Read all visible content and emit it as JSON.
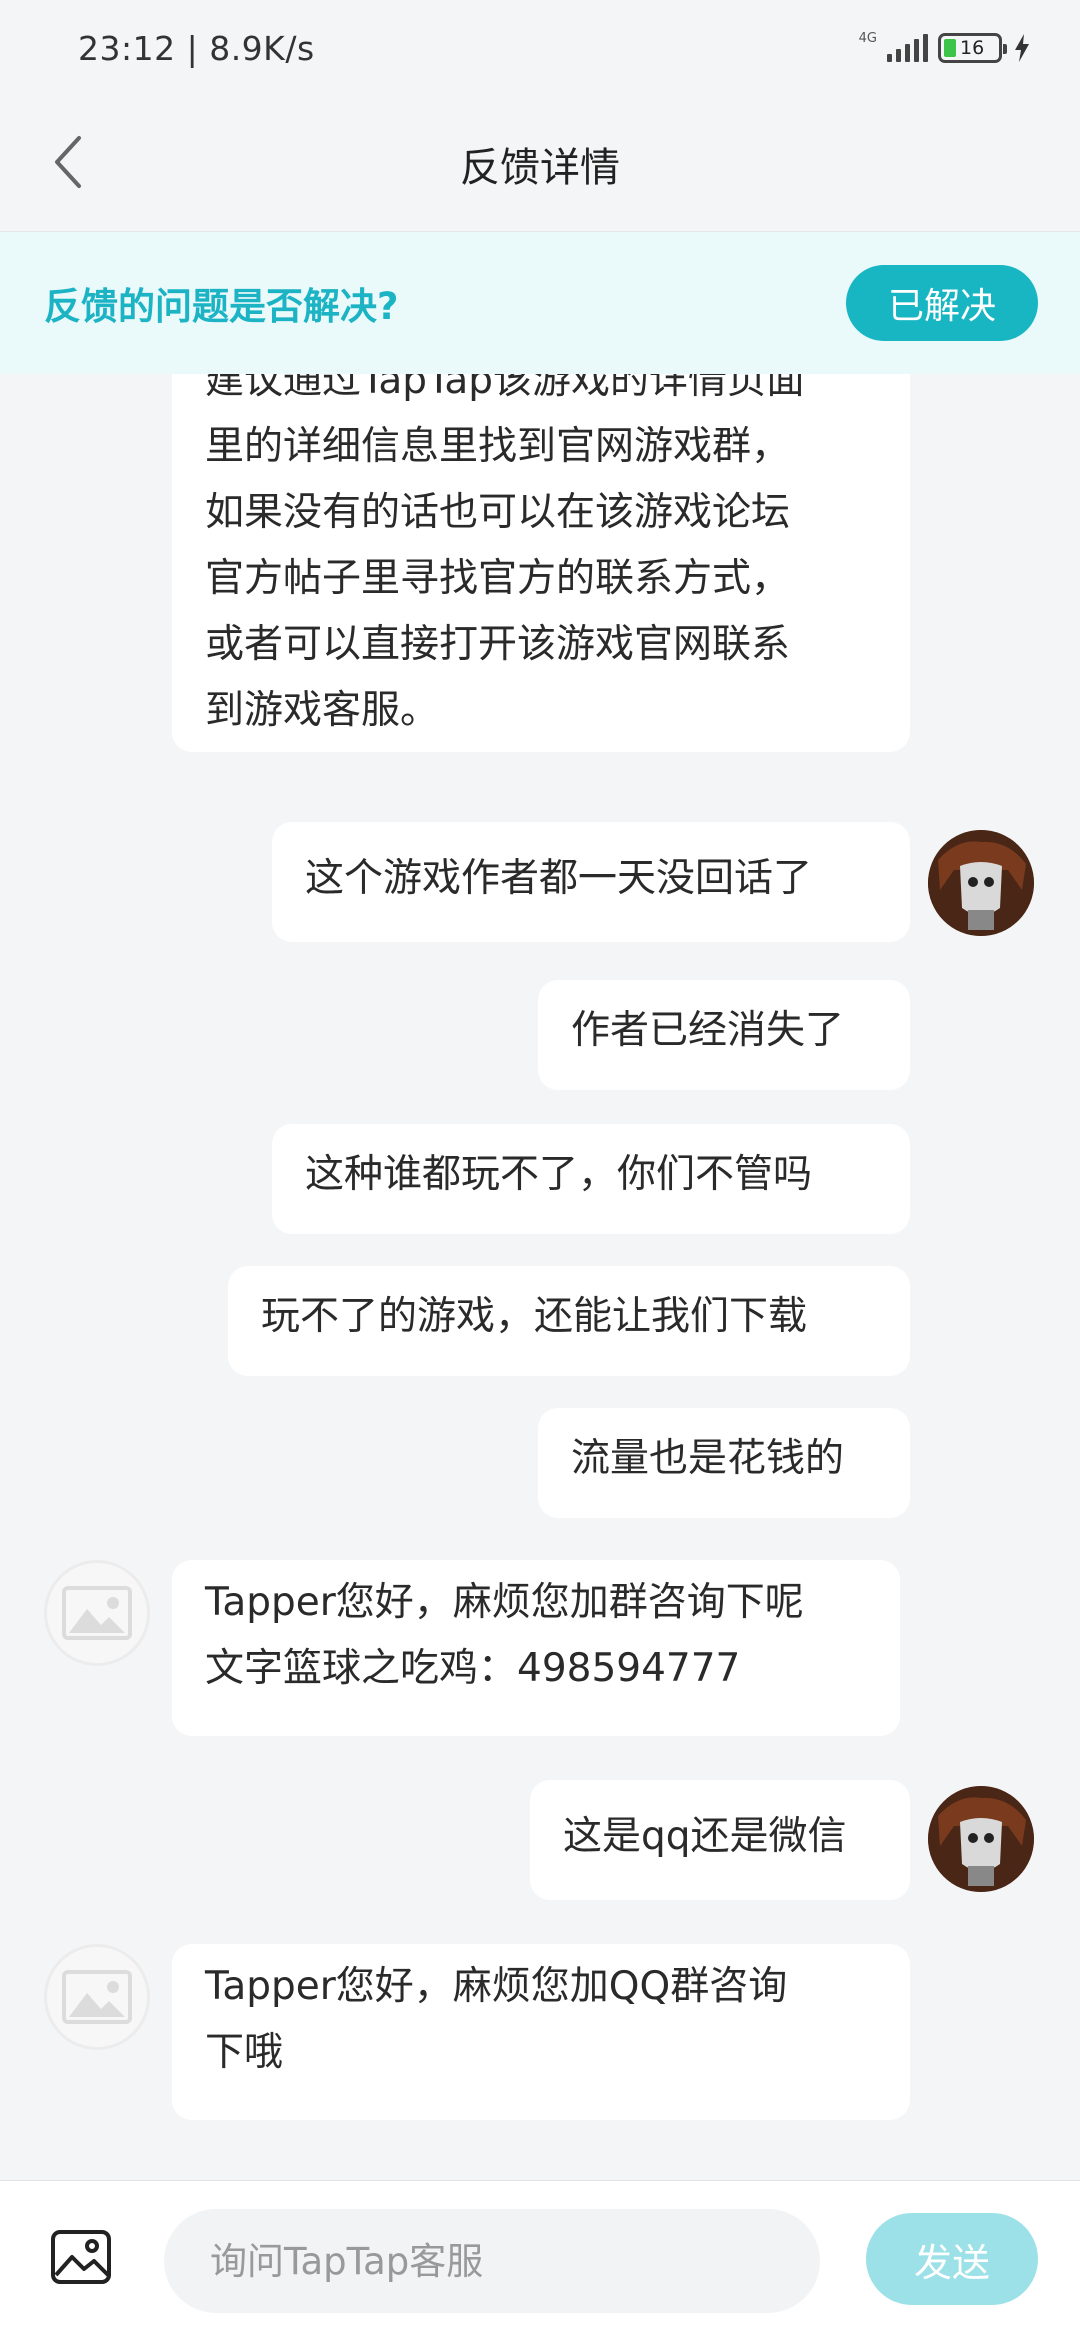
{
  "status_bar": {
    "time": "23:12 | 8.9K/s",
    "network": "4G",
    "battery": "16"
  },
  "header": {
    "title": "反馈详情"
  },
  "resolve_banner": {
    "question": "反馈的问题是否解决?",
    "resolved_label": "已解决"
  },
  "messages": [
    {
      "sender": "support",
      "text": "建议通过TapTap该游戏的详情页面\n里的详细信息里找到官网游戏群，\n如果没有的话也可以在该游戏论坛\n官方帖子里寻找官方的联系方式，\n或者可以直接打开该游戏官网联系\n到游戏客服。"
    },
    {
      "sender": "user",
      "text": "这个游戏作者都一天没回话了"
    },
    {
      "sender": "user",
      "text": "作者已经消失了"
    },
    {
      "sender": "user",
      "text": "这种谁都玩不了，你们不管吗"
    },
    {
      "sender": "user",
      "text": "玩不了的游戏，还能让我们下载"
    },
    {
      "sender": "user",
      "text": "流量也是花钱的"
    },
    {
      "sender": "support",
      "text": "Tapper您好，麻烦您加群咨询下呢\n文字篮球之吃鸡：498594777"
    },
    {
      "sender": "user",
      "text": "这是qq还是微信"
    },
    {
      "sender": "support",
      "text": "Tapper您好，麻烦您加QQ群咨询\n下哦"
    }
  ],
  "input_bar": {
    "placeholder": "询问TapTap客服",
    "send_label": "发送"
  },
  "colors": {
    "accent": "#18b6c3",
    "banner_bg": "#eaf9fa",
    "send_disabled": "#9be1e7",
    "page_bg": "#f4f5f7"
  }
}
